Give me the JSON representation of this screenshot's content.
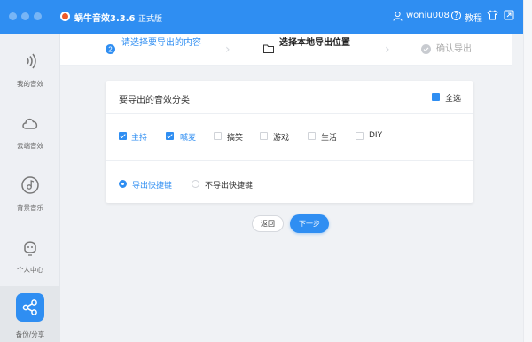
{
  "window": {
    "app_name": "蜗牛音效3.3.6",
    "app_edition": "正式版",
    "user_name": "woniu008",
    "help_label": "教程",
    "icons": {
      "app": "snail-logo-icon",
      "user": "user-icon",
      "help": "question-circle-icon",
      "skin": "shirt-icon",
      "mini": "mini-mode-icon"
    }
  },
  "sidebar": {
    "items": [
      {
        "label": "我的音效",
        "icon": "sound-waves-icon",
        "active": false
      },
      {
        "label": "云端音效",
        "icon": "cloud-icon",
        "active": false
      },
      {
        "label": "背景音乐",
        "icon": "music-disc-icon",
        "active": false
      },
      {
        "label": "个人中心",
        "icon": "profile-face-icon",
        "active": false
      },
      {
        "label": "备份/分享",
        "icon": "share-icon",
        "active": true
      }
    ]
  },
  "steps": [
    {
      "number": "2",
      "label": "请选择要导出的内容",
      "state": "done"
    },
    {
      "label": "选择本地导出位置",
      "state": "current",
      "icon": "folder-icon"
    },
    {
      "label": "确认导出",
      "state": "pending",
      "icon": "check-circle-icon"
    }
  ],
  "category_section": {
    "title": "要导出的音效分类",
    "select_all_label": "全选",
    "categories": [
      {
        "label": "主持",
        "checked": true
      },
      {
        "label": "喊麦",
        "checked": true
      },
      {
        "label": "搞笑",
        "checked": false
      },
      {
        "label": "游戏",
        "checked": false
      },
      {
        "label": "生活",
        "checked": false
      },
      {
        "label": "DIY",
        "checked": false
      }
    ]
  },
  "shortcut_section": {
    "options": [
      {
        "label": "导出快捷键",
        "selected": true
      },
      {
        "label": "不导出快捷键",
        "selected": false
      }
    ]
  },
  "buttons": {
    "back": "返回",
    "next": "下一步"
  },
  "colors": {
    "accent": "#2f8ef2",
    "sidebar_bg": "#eef0f4",
    "page_bg": "#f0f2f5"
  }
}
